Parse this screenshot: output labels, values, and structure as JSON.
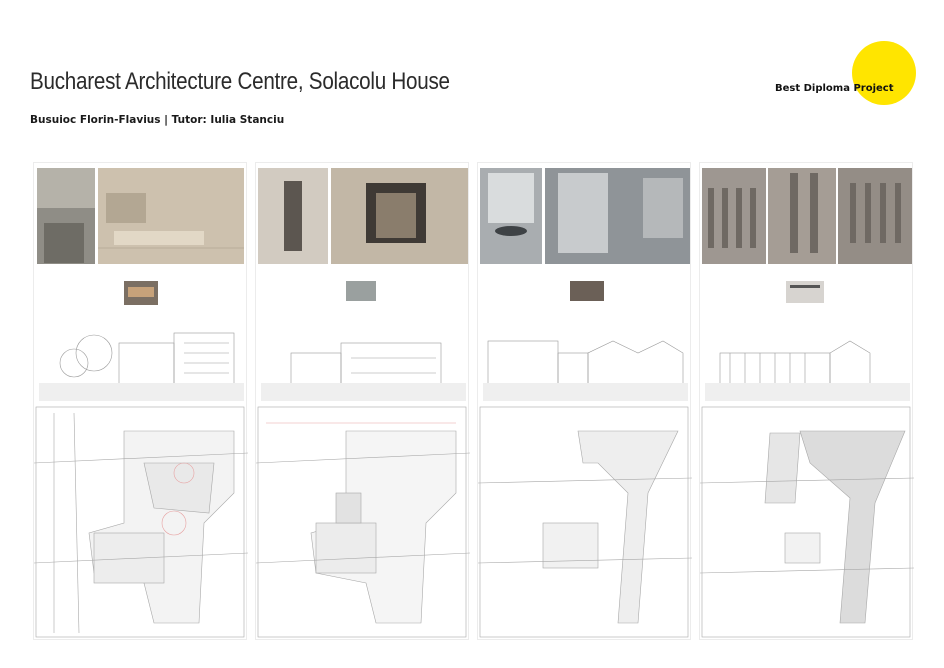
{
  "header": {
    "title": "Bucharest Architecture Centre, Solacolu House",
    "subtitle": "Busuioc Florin-Flavius | Tutor: Iulia Stanciu"
  },
  "badge": {
    "label": "Best Diploma Project",
    "color": "#FFE500"
  },
  "boards": [
    {
      "id": "board-1",
      "render_tone": "#c9bca8"
    },
    {
      "id": "board-2",
      "render_tone": "#b8aa96"
    },
    {
      "id": "board-3",
      "render_tone": "#8e9396"
    },
    {
      "id": "board-4",
      "render_tone": "#9a938c"
    }
  ]
}
